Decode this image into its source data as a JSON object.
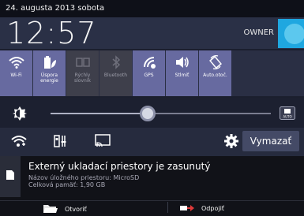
{
  "status": {
    "date": "24. augusta 2013 sobota"
  },
  "header": {
    "time": "12:57",
    "owner": "OWNER"
  },
  "tiles": [
    {
      "label": "Wi-Fi",
      "icon": "wifi-icon",
      "state": "on"
    },
    {
      "label": "Úspora energie",
      "icon": "battery-leaf-icon",
      "state": "on"
    },
    {
      "label": "Rýchly slovník",
      "icon": "dictionary-icon",
      "state": "off"
    },
    {
      "label": "Bluetooth",
      "icon": "bluetooth-icon",
      "state": "off"
    },
    {
      "label": "GPS",
      "icon": "gps-icon",
      "state": "on"
    },
    {
      "label": "Stlmiť",
      "icon": "vibrate-icon",
      "state": "on"
    },
    {
      "label": "Auto.otoč.",
      "icon": "auto-rotate-icon",
      "state": "on"
    }
  ],
  "brightness": {
    "level": 0.44,
    "auto_label": "AUTO"
  },
  "bottom_row": {
    "clear_label": "Vymazať"
  },
  "notification": {
    "title": "Externý ukladací priestory je zasunutý",
    "line1": "Názov úložného priestoru: MicroSD",
    "line2": "Celková pamäť: 1,90 GB",
    "action_open": "Otvoriť",
    "action_eject": "Odpojiť"
  },
  "colors": {
    "tile_on": "#676aa0",
    "tile_off": "#3e3f4b",
    "accent": "#1fa7e0"
  }
}
